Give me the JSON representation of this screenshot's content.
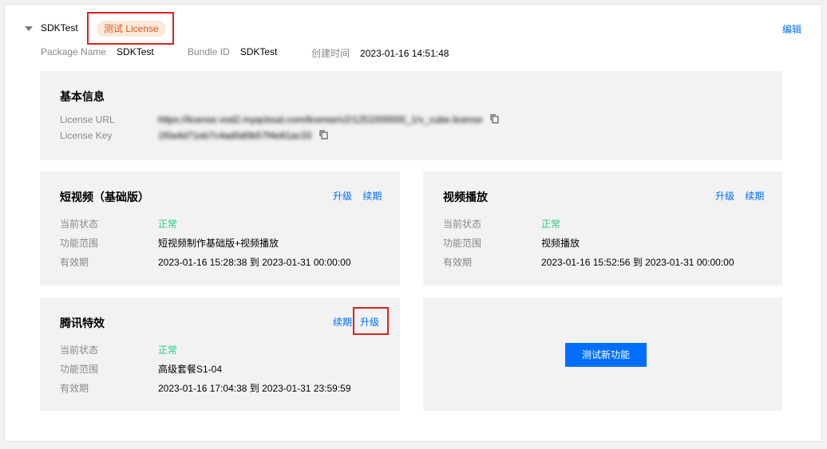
{
  "app": {
    "name": "SDKTest",
    "badge": "测试 License",
    "edit": "编辑"
  },
  "meta": [
    {
      "label": "Package Name",
      "value": "SDKTest"
    },
    {
      "label": "Bundle ID",
      "value": "SDKTest"
    },
    {
      "label": "创建时间",
      "value": "2023-01-16 14:51:48"
    }
  ],
  "basic": {
    "title": "基本信息",
    "url_label": "License URL",
    "url_value": "https://license.vod2.myqcloud.com/license/v2/1251000000_1/v_cube.license",
    "key_label": "License Key",
    "key_value": "1f0a4d71eb7c4ad0d0b57f4e81ac33"
  },
  "panels": {
    "short_video": {
      "title": "短视频（基础版）",
      "upgrade": "升级",
      "renew": "续期",
      "rows": [
        {
          "label": "当前状态",
          "value": "正常"
        },
        {
          "label": "功能范围",
          "value": "短视频制作基础版+视频播放"
        },
        {
          "label": "有效期",
          "value": "2023-01-16 15:28:38 到 2023-01-31 00:00:00"
        }
      ]
    },
    "video_play": {
      "title": "视频播放",
      "upgrade": "升级",
      "renew": "续期",
      "rows": [
        {
          "label": "当前状态",
          "value": "正常"
        },
        {
          "label": "功能范围",
          "value": "视频播放"
        },
        {
          "label": "有效期",
          "value": "2023-01-16 15:52:56 到 2023-01-31 00:00:00"
        }
      ]
    },
    "effects": {
      "title": "腾讯特效",
      "renew": "续期",
      "upgrade": "升级",
      "rows": [
        {
          "label": "当前状态",
          "value": "正常"
        },
        {
          "label": "功能范围",
          "value": "高级套餐S1-04"
        },
        {
          "label": "有效期",
          "value": "2023-01-16 17:04:38 到 2023-01-31 23:59:59"
        }
      ]
    },
    "new_feature": {
      "button": "测试新功能"
    }
  },
  "colors": {
    "accent": "#006eff",
    "ok": "#29cc85",
    "badge_text": "#d95a19",
    "badge_bg": "#fde8dc",
    "highlight": "#e02020"
  }
}
